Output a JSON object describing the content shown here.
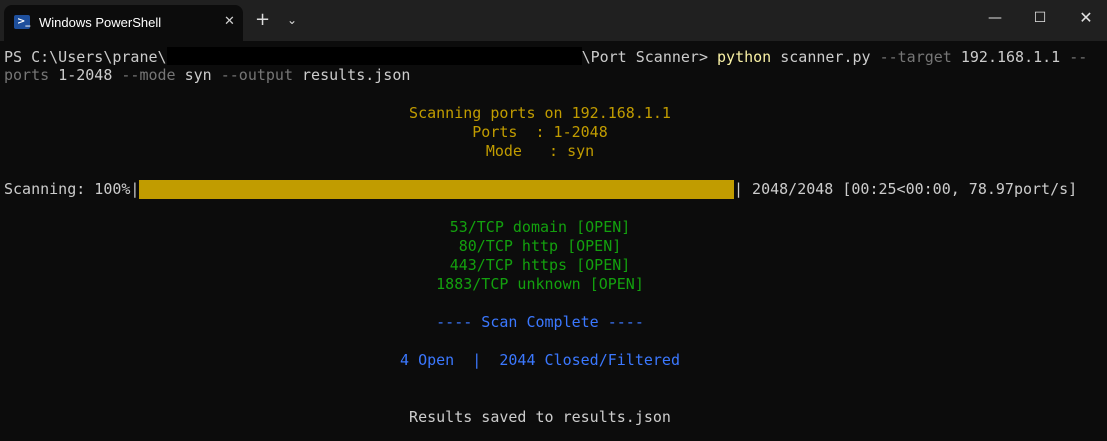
{
  "window": {
    "tab_title": "Windows PowerShell",
    "tab_icon": "powershell-icon",
    "close_tab_glyph": "✕",
    "new_tab_glyph": "+",
    "dropdown_glyph": "⌄",
    "minimize_glyph": "—",
    "maximize_glyph": "☐",
    "close_glyph": "✕"
  },
  "prompt": {
    "prefix": "PS C:\\Users\\prane\\",
    "suffix": "\\Port Scanner>",
    "command": "python",
    "arg1": "scanner.py",
    "flag_target": "--target",
    "target_value": "192.168.1.1",
    "flag_cont": "--",
    "ports_word": "ports",
    "ports_value": "1-2048",
    "flag_mode": "--mode",
    "mode_value": "syn",
    "flag_output": "--output",
    "output_value": "results.json"
  },
  "header": {
    "line1": "Scanning ports on 192.168.1.1",
    "line2": "Ports  : 1-2048",
    "line3": "Mode   : syn"
  },
  "progress": {
    "label": "Scanning: 100%|",
    "percent": 100,
    "stats": "| 2048/2048 [00:25<00:00, 78.97port/s]"
  },
  "results": [
    "53/TCP domain [OPEN]",
    "80/TCP http [OPEN]",
    "443/TCP https [OPEN]",
    "1883/TCP unknown [OPEN]"
  ],
  "summary": {
    "complete": "---- Scan Complete ----",
    "counts": "4 Open  |  2044 Closed/Filtered"
  },
  "saved": "Results saved to results.json",
  "colors": {
    "background": "#0c0c0c",
    "titlebar": "#202020",
    "progress_fill": "#c19c00",
    "open_green": "#13a10e",
    "summary_blue": "#3b78ff"
  }
}
